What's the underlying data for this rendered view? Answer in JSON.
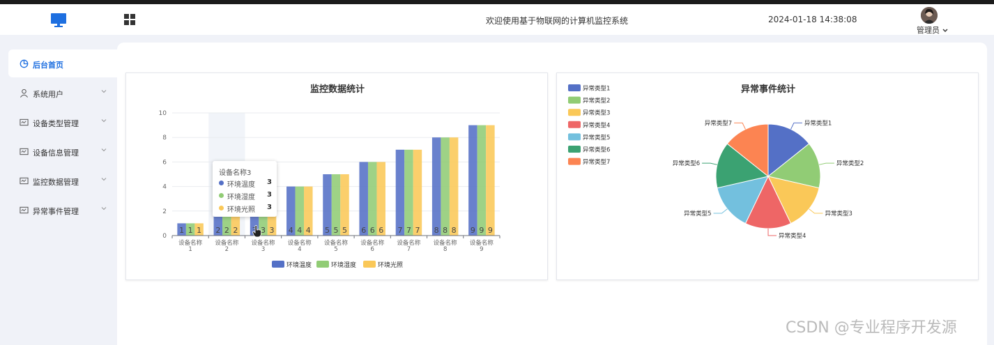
{
  "header": {
    "welcome_text": "欢迎使用基于物联网的计算机监控系统",
    "datetime": "2024-01-18 14:38:08",
    "user_label": "管理员",
    "logo_icon": "monitor-icon",
    "menu_toggle_icon": "grid-icon",
    "accent_color": "#1e6fe0"
  },
  "sidebar": {
    "items": [
      {
        "label": "后台首页",
        "icon": "dashboard-icon",
        "active": true,
        "has_submenu": false
      },
      {
        "label": "系统用户",
        "icon": "user-icon",
        "active": false,
        "has_submenu": true
      },
      {
        "label": "设备类型管理",
        "icon": "card-icon",
        "active": false,
        "has_submenu": true
      },
      {
        "label": "设备信息管理",
        "icon": "card-icon",
        "active": false,
        "has_submenu": true
      },
      {
        "label": "监控数据管理",
        "icon": "card-icon",
        "active": false,
        "has_submenu": true
      },
      {
        "label": "异常事件管理",
        "icon": "card-icon",
        "active": false,
        "has_submenu": true
      }
    ]
  },
  "tooltip": {
    "title": "设备名称3",
    "rows": [
      {
        "name": "环境温度",
        "value": "3"
      },
      {
        "name": "环境湿度",
        "value": "3"
      },
      {
        "name": "环境光照",
        "value": "3"
      }
    ]
  },
  "watermark": "CSDN @专业程序开发源",
  "chart_data": [
    {
      "type": "bar",
      "title": "监控数据统计",
      "categories": [
        "设备名称1",
        "设备名称2",
        "设备名称3",
        "设备名称4",
        "设备名称5",
        "设备名称6",
        "设备名称7",
        "设备名称8",
        "设备名称9"
      ],
      "category_lines": [
        [
          "设备名称",
          "1"
        ],
        [
          "设备名称",
          "2"
        ],
        [
          "设备名称",
          "3"
        ],
        [
          "设备名称",
          "4"
        ],
        [
          "设备名称",
          "5"
        ],
        [
          "设备名称",
          "6"
        ],
        [
          "设备名称",
          "7"
        ],
        [
          "设备名称",
          "8"
        ],
        [
          "设备名称",
          "9"
        ]
      ],
      "series": [
        {
          "name": "环境温度",
          "values": [
            1,
            2,
            3,
            4,
            5,
            6,
            7,
            8,
            9
          ],
          "color": "#5470c6"
        },
        {
          "name": "环境湿度",
          "values": [
            1,
            2,
            3,
            4,
            5,
            6,
            7,
            8,
            9
          ],
          "color": "#91cc75"
        },
        {
          "name": "环境光照",
          "values": [
            1,
            2,
            3,
            4,
            5,
            6,
            7,
            8,
            9
          ],
          "color": "#fac858"
        }
      ],
      "yticks": [
        "0",
        "2",
        "4",
        "6",
        "8",
        "10"
      ],
      "ylim": [
        0,
        10
      ],
      "highlighted_category": 1,
      "grid": true,
      "legend_position": "bottom"
    },
    {
      "type": "pie",
      "title": "异常事件统计",
      "slices": [
        {
          "label": "异常类型1",
          "value": 1,
          "color": "#5470c6"
        },
        {
          "label": "异常类型2",
          "value": 1,
          "color": "#91cc75"
        },
        {
          "label": "异常类型3",
          "value": 1,
          "color": "#fac858"
        },
        {
          "label": "异常类型4",
          "value": 1,
          "color": "#ee6666"
        },
        {
          "label": "异常类型5",
          "value": 1,
          "color": "#73c0de"
        },
        {
          "label": "异常类型6",
          "value": 1,
          "color": "#3ba272"
        },
        {
          "label": "异常类型7",
          "value": 1,
          "color": "#fc8452"
        }
      ],
      "legend_position": "top-left"
    }
  ]
}
